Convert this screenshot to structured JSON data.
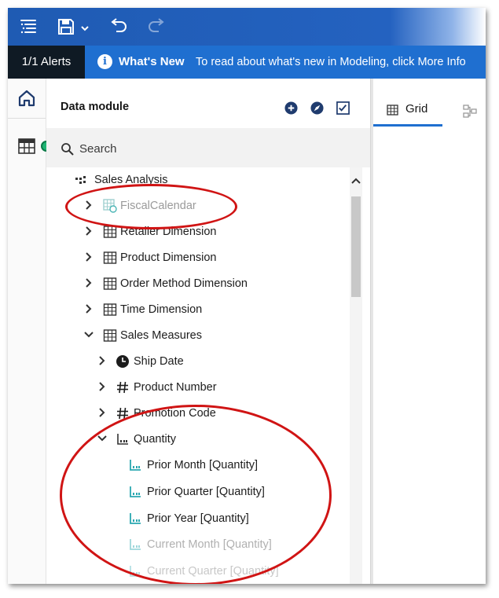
{
  "toolbar": {
    "menu_icon": "menu-icon",
    "save_icon": "save-icon",
    "undo_icon": "undo-icon",
    "redo_icon": "redo-icon"
  },
  "alerts": {
    "count_label": "1/1 Alerts",
    "whats_new_label": "What's New",
    "message": "To read about what's new in Modeling, click More Info"
  },
  "sidebar": {
    "title": "Data module",
    "search_placeholder": "Search"
  },
  "tree": {
    "root": "Sales Analysis",
    "items": [
      {
        "label": "FiscalCalendar"
      },
      {
        "label": "Retailer Dimension"
      },
      {
        "label": "Product Dimension"
      },
      {
        "label": "Order Method Dimension"
      },
      {
        "label": "Time Dimension"
      },
      {
        "label": "Sales Measures"
      },
      {
        "label": "Ship Date"
      },
      {
        "label": "Product Number"
      },
      {
        "label": "Promotion Code"
      },
      {
        "label": "Quantity"
      },
      {
        "label": "Prior Month [Quantity]"
      },
      {
        "label": "Prior Quarter [Quantity]"
      },
      {
        "label": "Prior Year [Quantity]"
      },
      {
        "label": "Current Month [Quantity]"
      },
      {
        "label": "Current Quarter [Quantity]"
      }
    ]
  },
  "right_pane": {
    "tab_grid_label": "Grid"
  },
  "colors": {
    "topbar": "#1f5bb3",
    "alertbar": "#1f6fd0",
    "alert_count_bg": "#0f1a24",
    "accent": "#1f6fd0",
    "status_dot": "#1fb574",
    "annotation": "#d01414",
    "measure_icon": "#2aa7b0"
  }
}
